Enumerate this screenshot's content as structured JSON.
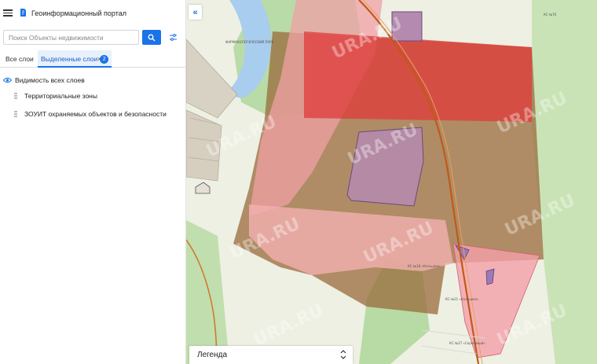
{
  "header": {
    "title": "Геоинформационный портал"
  },
  "search": {
    "placeholder": "Поиск Объекты недвижимости"
  },
  "tabs": {
    "all_label": "Все слои",
    "selected_label": "Выделенные слои",
    "selected_count": "2",
    "close_glyph": "×"
  },
  "layers": {
    "visibility_all_label": "Видимость всех слоев",
    "items": [
      {
        "label": "Территориальные зоны"
      },
      {
        "label": "ЗОУИТ охраняемых объектов и безопасности"
      }
    ]
  },
  "map": {
    "collapse_glyph": "«",
    "legend_label": "Легенда",
    "watermark": "URA.RU",
    "labels": {
      "park": "ФАРМАКОЛОГИЧЕСКИЙ ПАРК",
      "kc1": "КС №18 «Кольцово»",
      "kc2": "КС №21 «Кольцово»",
      "kc3": "КС №27 «Сереневый»",
      "kc4": "КС №76"
    }
  },
  "colors": {
    "accent": "#1a73e8",
    "zone_red": "#e03a3a",
    "zone_brown": "#8b5a2b",
    "zone_pink": "#f4a0a8"
  }
}
